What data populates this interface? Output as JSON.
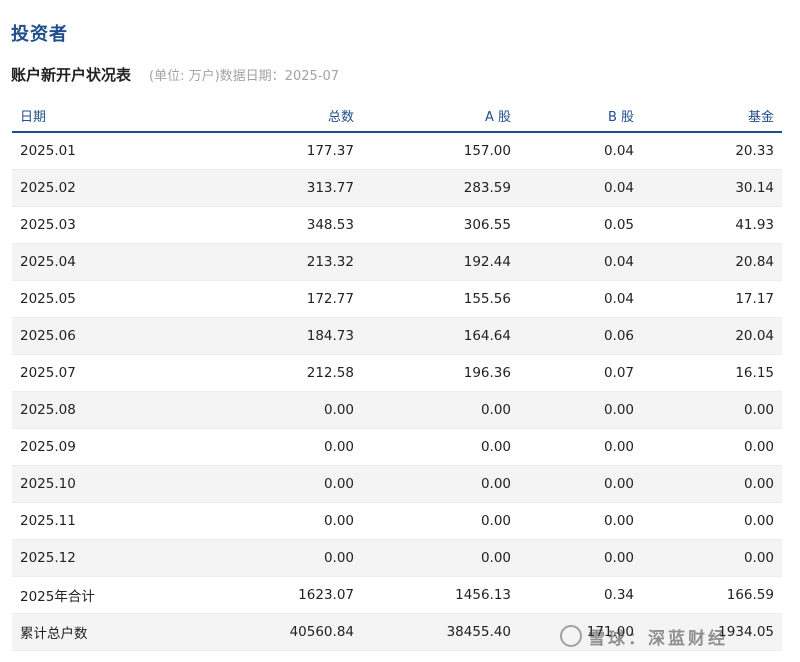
{
  "page_title": "投资者",
  "table_title": "账户新开户状况表",
  "table_meta": "(单位: 万户)数据日期：2025-07",
  "columns": [
    "日期",
    "总数",
    "A 股",
    "B 股",
    "基金"
  ],
  "rows": [
    [
      "2025.01",
      "177.37",
      "157.00",
      "0.04",
      "20.33"
    ],
    [
      "2025.02",
      "313.77",
      "283.59",
      "0.04",
      "30.14"
    ],
    [
      "2025.03",
      "348.53",
      "306.55",
      "0.05",
      "41.93"
    ],
    [
      "2025.04",
      "213.32",
      "192.44",
      "0.04",
      "20.84"
    ],
    [
      "2025.05",
      "172.77",
      "155.56",
      "0.04",
      "17.17"
    ],
    [
      "2025.06",
      "184.73",
      "164.64",
      "0.06",
      "20.04"
    ],
    [
      "2025.07",
      "212.58",
      "196.36",
      "0.07",
      "16.15"
    ],
    [
      "2025.08",
      "0.00",
      "0.00",
      "0.00",
      "0.00"
    ],
    [
      "2025.09",
      "0.00",
      "0.00",
      "0.00",
      "0.00"
    ],
    [
      "2025.10",
      "0.00",
      "0.00",
      "0.00",
      "0.00"
    ],
    [
      "2025.11",
      "0.00",
      "0.00",
      "0.00",
      "0.00"
    ],
    [
      "2025.12",
      "0.00",
      "0.00",
      "0.00",
      "0.00"
    ],
    [
      "2025年合计",
      "1623.07",
      "1456.13",
      "0.34",
      "166.59"
    ],
    [
      "累计总户数",
      "40560.84",
      "38455.40",
      "171.00",
      "1934.05"
    ]
  ],
  "watermark": "雪球：深蓝财经",
  "colors": {
    "accent": "#1f4e8c",
    "row_alt": "#f4f4f4",
    "meta_text": "#a3a3a3"
  }
}
